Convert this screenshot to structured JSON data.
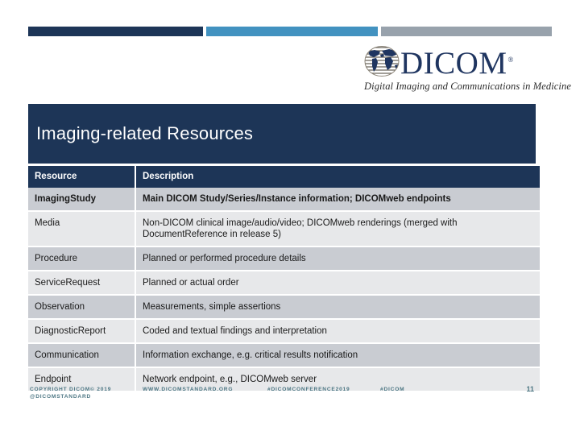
{
  "deck": {
    "slide_title": "Imaging-related Resources",
    "page_number": "11"
  },
  "topbars": {
    "navy_color": "#1d3557",
    "blue_color": "#4292c0",
    "gray_color": "#98a2ac"
  },
  "logo": {
    "icon": "dicom-globe-icon",
    "wordmark": "DICOM",
    "registered_mark": "®",
    "tagline": "Digital Imaging and Communications in Medicine",
    "color": "#1f3560"
  },
  "table": {
    "headers": [
      "Resource",
      "Description"
    ],
    "rows": [
      {
        "resource": "ImagingStudy",
        "description": "Main DICOM Study/Series/Instance information; DICOMweb endpoints"
      },
      {
        "resource": "Media",
        "description": "Non-DICOM clinical image/audio/video; DICOMweb renderings (merged with DocumentReference in release 5)"
      },
      {
        "resource": "Procedure",
        "description": "Planned or performed procedure details"
      },
      {
        "resource": "ServiceRequest",
        "description": "Planned or actual order"
      },
      {
        "resource": "Observation",
        "description": "Measurements, simple assertions"
      },
      {
        "resource": "DiagnosticReport",
        "description": "Coded and textual findings and interpretation"
      },
      {
        "resource": "Communication",
        "description": "Information exchange, e.g. critical results notification"
      },
      {
        "resource": "Endpoint",
        "description": "Network endpoint, e.g., DICOMweb server"
      }
    ]
  },
  "footer": {
    "copyright": "COPYRIGHT DICOM© 2019",
    "handle": "@DICOMSTANDARD",
    "website": "WWW.DICOMSTANDARD.ORG",
    "hashtag_conference": "#DICOMCONFERENCE2019",
    "hashtag_brand": "#DICOM"
  }
}
